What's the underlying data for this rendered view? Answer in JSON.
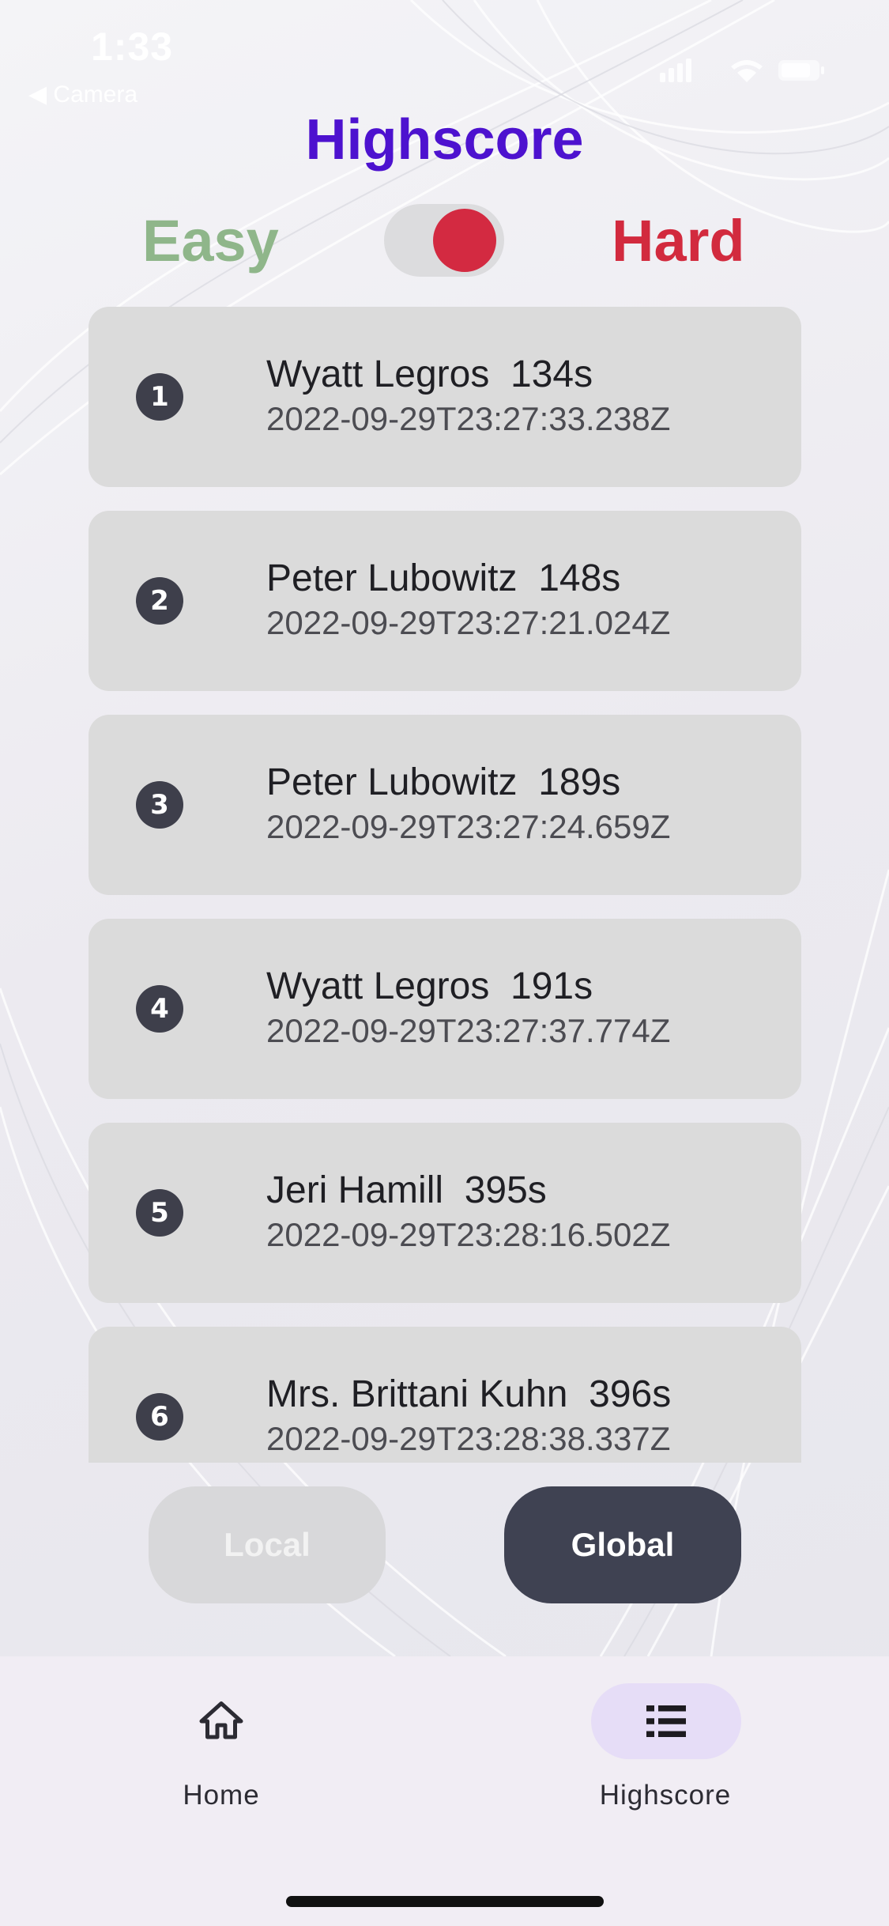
{
  "status_bar": {
    "time": "1:33",
    "back_label": "◀ Camera"
  },
  "title": "Highscore",
  "difficulty": {
    "easy_label": "Easy",
    "hard_label": "Hard",
    "selected": "Hard",
    "easy_color": "#8fb68a",
    "hard_color": "#d22a3e"
  },
  "scores": [
    {
      "rank": "1",
      "name": "Wyatt Legros",
      "time": "134s",
      "date": "2022-09-29T23:27:33.238Z"
    },
    {
      "rank": "2",
      "name": "Peter Lubowitz",
      "time": "148s",
      "date": "2022-09-29T23:27:21.024Z"
    },
    {
      "rank": "3",
      "name": "Peter Lubowitz",
      "time": "189s",
      "date": "2022-09-29T23:27:24.659Z"
    },
    {
      "rank": "4",
      "name": "Wyatt Legros",
      "time": "191s",
      "date": "2022-09-29T23:27:37.774Z"
    },
    {
      "rank": "5",
      "name": "Jeri Hamill",
      "time": "395s",
      "date": "2022-09-29T23:28:16.502Z"
    },
    {
      "rank": "6",
      "name": "Mrs. Brittani Kuhn",
      "time": "396s",
      "date": "2022-09-29T23:28:38.337Z"
    }
  ],
  "buttons": {
    "local_label": "Local",
    "global_label": "Global",
    "selected": "Global"
  },
  "nav": {
    "home_label": "Home",
    "home_icon": "home-icon",
    "highscore_label": "Highscore",
    "highscore_icon": "list-icon",
    "active": "Highscore"
  },
  "colors": {
    "title": "#4d12cf",
    "accent_dark": "#3f4252",
    "card": "#dbdbdb",
    "nav_active_pill": "#e6ddf7"
  }
}
